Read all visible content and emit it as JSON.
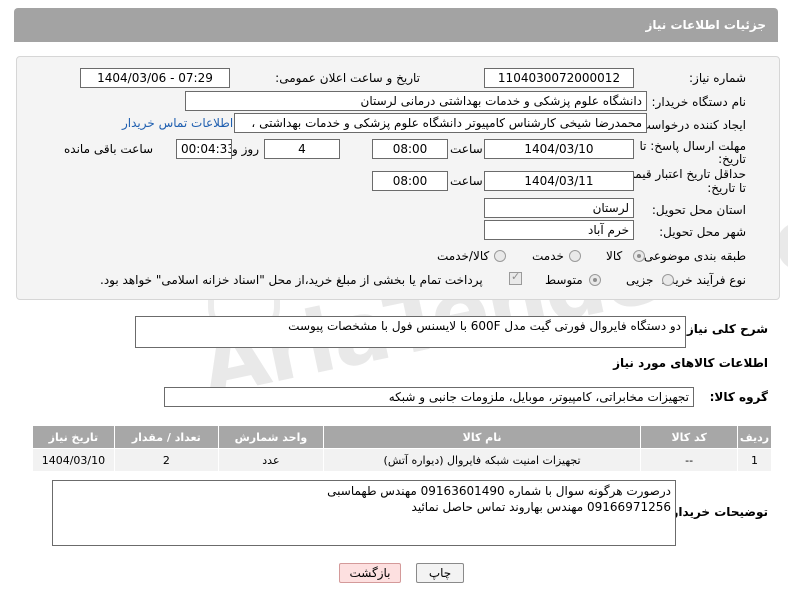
{
  "page": {
    "title": "جزئیات اطلاعات نیاز"
  },
  "watermark": {
    "text": "AriaTender.neT"
  },
  "form": {
    "need_number": {
      "label": "شماره نیاز:",
      "value": "1104030072000012"
    },
    "announce_datetime": {
      "label": "تاریخ و ساعت اعلان عمومی:",
      "value": "1404/03/06 - 07:29"
    },
    "buyer_org": {
      "label": "نام دستگاه خریدار:",
      "value": "دانشگاه علوم پزشکی و خدمات بهداشتی درمانی لرستان"
    },
    "requester": {
      "label": "ایجاد کننده درخواست:",
      "value": "محمدرضا شیخی کارشناس کامپیوتر دانشگاه علوم پزشکی و خدمات بهداشتی ،",
      "link": "اطلاعات تماس خریدار"
    },
    "reply_deadline": {
      "label_line1": "مهلت ارسال پاسخ: تا",
      "label_line2": "تاریخ:",
      "date": "1404/03/10",
      "time_label": "ساعت",
      "time": "08:00",
      "days": "4",
      "days_label": "روز و",
      "remaining": "00:04:33",
      "remaining_label": "ساعت باقی مانده"
    },
    "price_validity": {
      "label_line1": "حداقل تاریخ اعتبار قیمت:",
      "label_line2": "تا تاریخ:",
      "date": "1404/03/11",
      "time_label": "ساعت",
      "time": "08:00"
    },
    "delivery_province": {
      "label": "استان محل تحویل:",
      "value": "لرستان"
    },
    "delivery_city": {
      "label": "شهر محل تحویل:",
      "value": "خرم آباد"
    },
    "category": {
      "label": "طبقه بندی موضوعی:",
      "options": [
        "کالا",
        "خدمت",
        "کالا/خدمت"
      ],
      "selected": "کالا"
    },
    "purchase_process": {
      "label": "نوع فرآیند خرید :",
      "options": [
        "جزیی",
        "متوسط"
      ],
      "selected": "متوسط",
      "payment_note": "پرداخت تمام یا بخشی از مبلغ خرید،از محل \"اسناد خزانه اسلامی\" خواهد بود."
    }
  },
  "description": {
    "label": "شرح کلی نیاز:",
    "value": "دو دستگاه فایروال فورتی گیت مدل 600F با لایسنس فول با مشخصات پیوست"
  },
  "goods": {
    "section_title": "اطلاعات کالاهای مورد نیاز",
    "group_label": "گروه کالا:",
    "group_value": "تجهیزات مخابراتی، کامپیوتر، موبایل، ملزومات جانبی و شبکه",
    "columns": [
      "ردیف",
      "کد کالا",
      "نام کالا",
      "واحد شمارش",
      "تعداد / مقدار",
      "تاریخ نیاز"
    ],
    "rows": [
      [
        "1",
        "--",
        "تجهیزات امنیت شبکه فایروال (دیواره آتش)",
        "عدد",
        "2",
        "1404/03/10"
      ]
    ]
  },
  "buyer_notes": {
    "label": "توضیحات خریدار:",
    "line1": "درصورت هرگونه سوال با شماره 09163601490 مهندس طهماسبی",
    "line2": "09166971256 مهندس بهاروند تماس حاصل نمائید"
  },
  "buttons": {
    "print": "چاپ",
    "back": "بازگشت"
  }
}
